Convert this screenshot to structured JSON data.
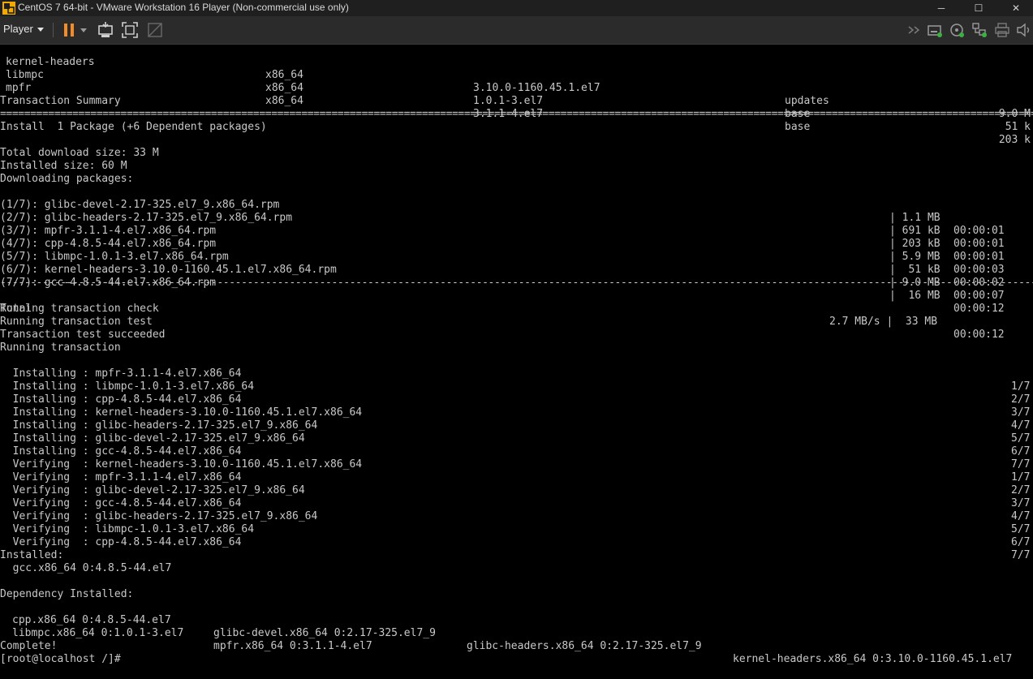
{
  "window": {
    "title": "CentOS 7 64-bit - VMware Workstation 16 Player (Non-commercial use only)",
    "minimize_glyph": "─",
    "maximize_glyph": "☐",
    "close_glyph": "✕"
  },
  "toolbar": {
    "player_label": "Player",
    "icons": [
      "pause-icon",
      "pause-dropdown-icon",
      "send-ctrl-alt-del-icon",
      "fullscreen-icon",
      "unity-icon",
      "forward-icon",
      "removable-device-icon",
      "cd-dvd-icon",
      "network-adapter-icon",
      "printer-icon",
      "sound-icon"
    ]
  },
  "terminal": {
    "packages": [
      {
        "name": "kernel-headers",
        "arch": "x86_64",
        "version": "3.10.0-1160.45.1.el7",
        "repo": "updates",
        "size": "9.0 M"
      },
      {
        "name": "libmpc",
        "arch": "x86_64",
        "version": "1.0.1-3.el7",
        "repo": "base",
        "size": "51 k"
      },
      {
        "name": "mpfr",
        "arch": "x86_64",
        "version": "3.1.1-4.el7",
        "repo": "base",
        "size": "203 k"
      }
    ],
    "summary_title": "Transaction Summary",
    "separator": "================================================================================================================================================================================",
    "dash_separator": "--------------------------------------------------------------------------------------------------------------------------------------------------------------------------------",
    "install_line": "Install  1 Package (+6 Dependent packages)",
    "download_size": "Total download size: 33 M",
    "installed_size": "Installed size: 60 M",
    "downloading": "Downloading packages:",
    "downloads": [
      {
        "name": "(1/7): glibc-devel-2.17-325.el7_9.x86_64.rpm",
        "size": "| 1.1 MB",
        "time": "00:00:01"
      },
      {
        "name": "(2/7): glibc-headers-2.17-325.el7_9.x86_64.rpm",
        "size": "| 691 kB",
        "time": "00:00:01"
      },
      {
        "name": "(3/7): mpfr-3.1.1-4.el7.x86_64.rpm",
        "size": "| 203 kB",
        "time": "00:00:01"
      },
      {
        "name": "(4/7): cpp-4.8.5-44.el7.x86_64.rpm",
        "size": "| 5.9 MB",
        "time": "00:00:03"
      },
      {
        "name": "(5/7): libmpc-1.0.1-3.el7.x86_64.rpm",
        "size": "|  51 kB",
        "time": "00:00:02"
      },
      {
        "name": "(6/7): kernel-headers-3.10.0-1160.45.1.el7.x86_64.rpm",
        "size": "| 9.0 MB",
        "time": "00:00:07"
      },
      {
        "name": "(7/7): gcc-4.8.5-44.el7.x86_64.rpm",
        "size": "|  16 MB",
        "time": "00:00:12"
      }
    ],
    "total": {
      "label": "Total",
      "size": "2.7 MB/s |  33 MB",
      "time": "00:00:12"
    },
    "transaction_lines": [
      "Running transaction check",
      "Running transaction test",
      "Transaction test succeeded",
      "Running transaction"
    ],
    "steps": [
      {
        "text": "  Installing : mpfr-3.1.1-4.el7.x86_64",
        "count": "1/7"
      },
      {
        "text": "  Installing : libmpc-1.0.1-3.el7.x86_64",
        "count": "2/7"
      },
      {
        "text": "  Installing : cpp-4.8.5-44.el7.x86_64",
        "count": "3/7"
      },
      {
        "text": "  Installing : kernel-headers-3.10.0-1160.45.1.el7.x86_64",
        "count": "4/7"
      },
      {
        "text": "  Installing : glibc-headers-2.17-325.el7_9.x86_64",
        "count": "5/7"
      },
      {
        "text": "  Installing : glibc-devel-2.17-325.el7_9.x86_64",
        "count": "6/7"
      },
      {
        "text": "  Installing : gcc-4.8.5-44.el7.x86_64",
        "count": "7/7"
      },
      {
        "text": "  Verifying  : kernel-headers-3.10.0-1160.45.1.el7.x86_64",
        "count": "1/7"
      },
      {
        "text": "  Verifying  : mpfr-3.1.1-4.el7.x86_64",
        "count": "2/7"
      },
      {
        "text": "  Verifying  : glibc-devel-2.17-325.el7_9.x86_64",
        "count": "3/7"
      },
      {
        "text": "  Verifying  : gcc-4.8.5-44.el7.x86_64",
        "count": "4/7"
      },
      {
        "text": "  Verifying  : glibc-headers-2.17-325.el7_9.x86_64",
        "count": "5/7"
      },
      {
        "text": "  Verifying  : libmpc-1.0.1-3.el7.x86_64",
        "count": "6/7"
      },
      {
        "text": "  Verifying  : cpp-4.8.5-44.el7.x86_64",
        "count": "7/7"
      }
    ],
    "installed_title": "Installed:",
    "installed_item": "  gcc.x86_64 0:4.8.5-44.el7",
    "dep_title": "Dependency Installed:",
    "deps_row1": [
      "cpp.x86_64 0:4.8.5-44.el7",
      "glibc-devel.x86_64 0:2.17-325.el7_9",
      "glibc-headers.x86_64 0:2.17-325.el7_9",
      "kernel-headers.x86_64 0:3.10.0-1160.45.1.el7"
    ],
    "deps_row2": [
      "libmpc.x86_64 0:1.0.1-3.el7",
      "mpfr.x86_64 0:3.1.1-4.el7"
    ],
    "complete": "Complete!",
    "prompt": "[root@localhost /]#"
  }
}
